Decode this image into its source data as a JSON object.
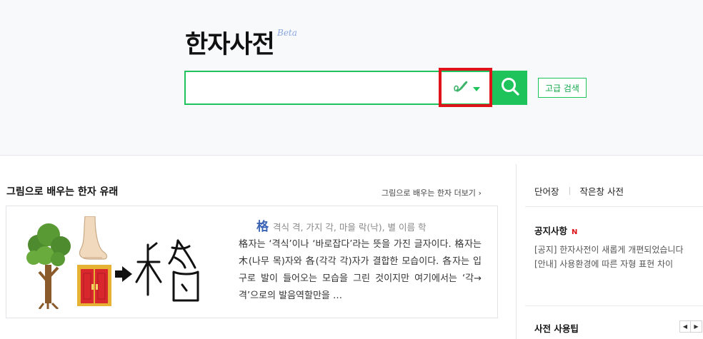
{
  "header": {
    "logo": "한자사전",
    "beta": "Beta"
  },
  "search": {
    "value": "",
    "placeholder": "",
    "advanced_label": "고급 검색"
  },
  "feature": {
    "title": "그림으로 배우는 한자 유래",
    "more_label": "그림으로 배우는 한자 더보기",
    "char": "格",
    "meanings": "격식 격, 가지 각, 마을 락(낙), 별 이름 학",
    "body": "格자는 ‘격식’이나 ‘바로잡다’라는 뜻을 가진 글자이다. 格자는 木(나무 목)자와 各(각각 각)자가 결합한 모습이다. 各자는 입구로 발이 들어오는 모습을 그린 것이지만 여기에서는 ‘각→격’으로의 발음역할만을 …"
  },
  "sidebar": {
    "tabs": [
      "단어장",
      "작은창 사전"
    ],
    "notice_title": "공지사항",
    "notice_new": "N",
    "notices": [
      "[공지] 한자사전이 새롭게 개편되었습니다",
      "[안내] 사용환경에 따른 자형 표현 차이"
    ],
    "tips_title": "사전 사용팁"
  },
  "colors": {
    "accent": "#1ec35c",
    "highlight": "#e0131a",
    "char": "#3a63b5"
  }
}
